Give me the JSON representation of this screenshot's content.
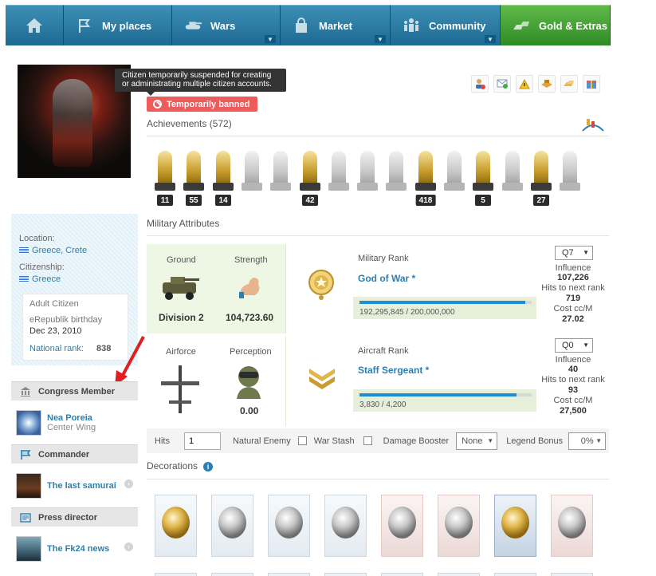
{
  "nav": {
    "tabs": [
      {
        "label": "My places"
      },
      {
        "label": "Wars"
      },
      {
        "label": "Market"
      },
      {
        "label": "Community"
      },
      {
        "label": "Gold & Extras"
      }
    ]
  },
  "profile": {
    "tooltip": "Citizen temporarily suspended for creating or administrating multiple citizen accounts.",
    "ban_label": "Temporarily banned",
    "location_label": "Location:",
    "location_value": "Greece, Crete",
    "citizenship_label": "Citizenship:",
    "citizenship_value": "Greece",
    "card": {
      "type": "Adult Citizen",
      "birthday_label": "eRepublik birthday",
      "birthday": "Dec 23, 2010",
      "rank_label": "National rank:",
      "rank_value": "838"
    }
  },
  "sidebar": {
    "sections": [
      {
        "title": "Congress Member",
        "name": "Nea Poreia",
        "sub": "Center Wing"
      },
      {
        "title": "Commander",
        "name": "The last samurai",
        "sub": ""
      },
      {
        "title": "Press director",
        "name": "The Fk24 news",
        "sub": ""
      }
    ]
  },
  "achievements": {
    "title": "Achievements (572)",
    "items": [
      {
        "count": "11",
        "gold": true
      },
      {
        "count": "55",
        "gold": true
      },
      {
        "count": "14",
        "gold": true
      },
      {
        "count": "",
        "gold": false
      },
      {
        "count": "",
        "gold": false
      },
      {
        "count": "42",
        "gold": true
      },
      {
        "count": "",
        "gold": false
      },
      {
        "count": "",
        "gold": false
      },
      {
        "count": "",
        "gold": false
      },
      {
        "count": "418",
        "gold": true
      },
      {
        "count": "",
        "gold": false
      },
      {
        "count": "5",
        "gold": true
      },
      {
        "count": "",
        "gold": false
      },
      {
        "count": "27",
        "gold": true
      },
      {
        "count": "",
        "gold": false
      }
    ]
  },
  "military": {
    "title": "Military Attributes",
    "ground": {
      "label": "Ground",
      "division": "Division 2",
      "strength_label": "Strength",
      "strength": "104,723.60",
      "rank_label": "Military Rank",
      "rank": "God of War *",
      "progress_text": "192,295,845 / 200,000,000",
      "progress": 0.961,
      "quality": "Q7",
      "influence_label": "Influence",
      "influence": "107,226",
      "hits_label": "Hits to next rank",
      "hits": "719",
      "cost_label": "Cost cc/M",
      "cost": "27.02"
    },
    "air": {
      "label": "Airforce",
      "perception_label": "Perception",
      "perception": "0.00",
      "rank_label": "Aircraft Rank",
      "rank": "Staff Sergeant *",
      "progress_text": "3,830 / 4,200",
      "progress": 0.912,
      "quality": "Q0",
      "influence_label": "Influence",
      "influence": "40",
      "hits_label": "Hits to next rank",
      "hits": "93",
      "cost_label": "Cost cc/M",
      "cost": "27,500"
    },
    "filters": {
      "hits_label": "Hits",
      "hits_value": "1",
      "natural_enemy": "Natural Enemy",
      "war_stash": "War Stash",
      "damage_booster": "Damage Booster",
      "booster_value": "None",
      "legend_bonus": "Legend Bonus",
      "legend_value": "0%"
    }
  },
  "decorations": {
    "title": "Decorations"
  },
  "colors": {
    "accent": "#2c7fb0",
    "ban": "#ef5b5b",
    "nav": "#1d6a93",
    "gold_tab": "#2f8c24",
    "progress": "#1e8ed6"
  }
}
